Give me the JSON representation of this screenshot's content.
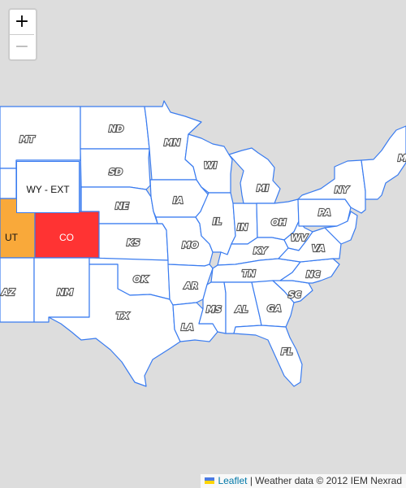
{
  "zoom": {
    "in_label": "+",
    "out_label": "−"
  },
  "attribution": {
    "link_text": "Leaflet",
    "text": "| Weather data © 2012 IEM Nexrad"
  },
  "popup": {
    "text": "WY - EXT"
  },
  "colors": {
    "UT": "#f9a93a",
    "CO": "#ff3333",
    "base_fill": "#ffffff",
    "border": "#3a7cf0",
    "background": "#dddddd"
  },
  "states": {
    "MT": "MT",
    "ND": "ND",
    "MN": "MN",
    "SD": "SD",
    "WI": "WI",
    "MI": "MI",
    "NE": "NE",
    "IA": "IA",
    "NY": "NY",
    "IL": "IL",
    "IN": "IN",
    "OH": "OH",
    "PA": "PA",
    "UT": "UT",
    "CO": "CO",
    "KS": "KS",
    "MO": "MO",
    "KY": "KY",
    "WV": "WV",
    "VA": "VA",
    "AZ": "AZ",
    "NM": "NM",
    "OK": "OK",
    "AR": "AR",
    "TN": "TN",
    "NC": "NC",
    "SC": "SC",
    "TX": "TX",
    "MS": "MS",
    "AL": "AL",
    "GA": "GA",
    "LA": "LA",
    "FL": "FL",
    "ME": "M"
  }
}
